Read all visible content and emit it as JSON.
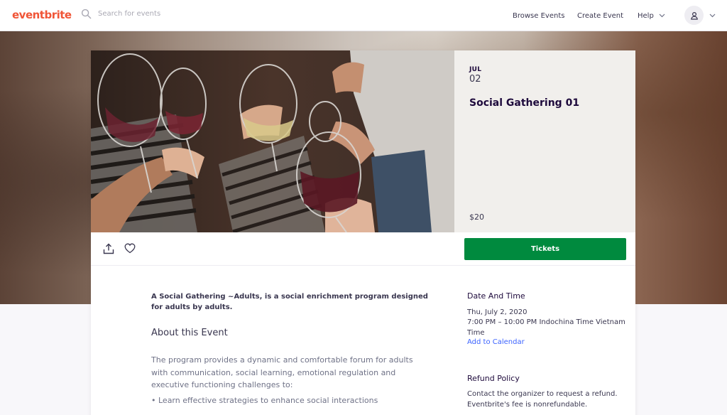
{
  "header": {
    "logo": "eventbrite",
    "search_placeholder": "Search for events",
    "nav": {
      "browse": "Browse Events",
      "create": "Create Event",
      "help": "Help"
    }
  },
  "event": {
    "month": "JUL",
    "day": "02",
    "title": "Social Gathering 01",
    "price": "$20",
    "tickets_label": "Tickets"
  },
  "body": {
    "summary": "A Social Gathering ~Adults, is a social enrichment program designed for adults by adults.",
    "about_heading": "About this Event",
    "about_paragraph": "The program provides a dynamic and comfortable forum for adults with communication, social learning, emotional regulation and executive functioning challenges to:",
    "bullet": "• Learn effective strategies to enhance social interactions"
  },
  "sidebar": {
    "date_time_heading": "Date And Time",
    "date": "Thu, July 2, 2020",
    "time": "7:00 PM – 10:00 PM Indochina Time Vietnam Time",
    "add_to_calendar": "Add to Calendar",
    "refund_heading": "Refund Policy",
    "refund_text": "Contact the organizer to request a refund. Eventbrite's fee is nonrefundable."
  },
  "colors": {
    "brand": "#f05537",
    "tickets_button": "#008a3e",
    "link": "#3d64ff",
    "title": "#1e0a3c"
  },
  "icons": [
    "search-icon",
    "chevron-down-icon",
    "user-icon",
    "share-icon",
    "heart-icon"
  ]
}
